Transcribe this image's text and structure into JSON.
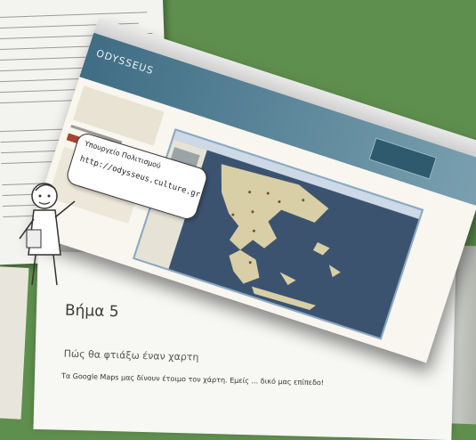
{
  "document": {
    "step_heading": "Βήμα 5",
    "question": "Πώς θα φτιάξω έναν χαρτη",
    "body_text": "Τα Google Maps μας δίνουν έτοιμο τον χάρτη. Εμείς ... δικό μας επίπεδο!"
  },
  "screenshot": {
    "site_logo": "ODYSSEUS"
  },
  "bubble": {
    "line1": "Υπουργείο Πολιτισμού",
    "line2": "http://odysseus.culture.gr"
  },
  "colors": {
    "background": "#5f8f4e",
    "site_header": "#3f6d84",
    "map_sea": "#3c5370",
    "map_land": "#d8cfa6",
    "accent_red": "#a54432"
  }
}
